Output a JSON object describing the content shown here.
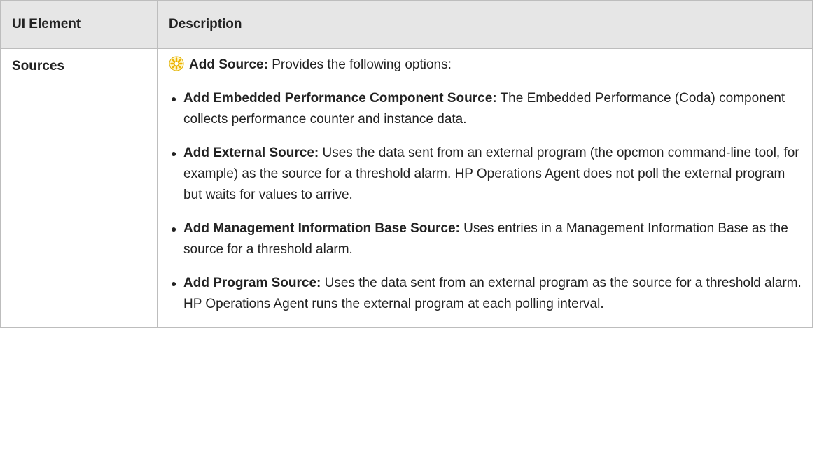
{
  "table": {
    "headers": {
      "element": "UI Element",
      "description": "Description"
    },
    "rows": [
      {
        "element": "Sources",
        "intro": {
          "icon": "add-star-icon",
          "label": "Add Source:",
          "text": " Provides the following options:"
        },
        "options": [
          {
            "label": "Add Embedded Performance Component Source:",
            "text": " The Embedded Performance (Coda) component collects performance counter and instance data."
          },
          {
            "label": "Add External Source:",
            "text": " Uses the data sent from an external program (the opcmon command-line tool, for example) as the source for a threshold alarm. HP Operations Agent does not poll the external program but waits for values to arrive."
          },
          {
            "label": "Add Management Information Base Source:",
            "text": " Uses entries in a Management Information Base as the source for a threshold alarm."
          },
          {
            "label": "Add Program Source:",
            "text": " Uses the data sent from an external program as the source for a threshold alarm. HP Operations Agent runs the external program at each polling interval."
          }
        ]
      }
    ]
  },
  "colors": {
    "header_bg": "#e6e6e6",
    "border": "#bdbdbd",
    "icon_yellow": "#f2c200"
  }
}
